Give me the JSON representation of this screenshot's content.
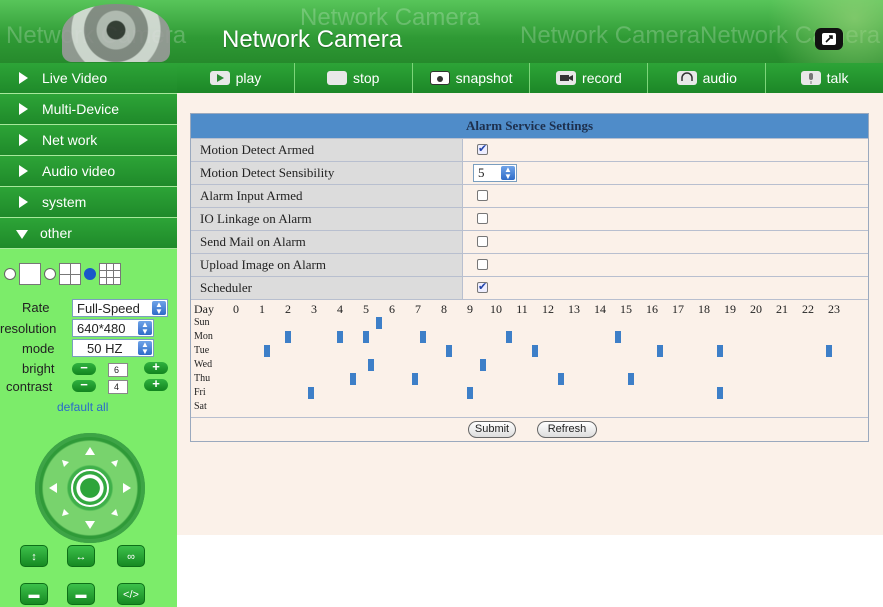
{
  "header": {
    "title": "Network Camera",
    "watermark": "Network Camera",
    "fullscreen_icon": "fullscreen-icon"
  },
  "sidebar": {
    "menu": [
      {
        "label": "Live Video",
        "expanded": false
      },
      {
        "label": "Multi-Device",
        "expanded": false
      },
      {
        "label": "Net work",
        "expanded": false
      },
      {
        "label": "Audio video",
        "expanded": false
      },
      {
        "label": "system",
        "expanded": false
      },
      {
        "label": "other",
        "expanded": true
      }
    ],
    "controls": {
      "rate_label": "Rate",
      "rate_value": "Full-Speed",
      "resolution_label": "resolution",
      "resolution_value": "640*480",
      "mode_label": "mode",
      "mode_value": "50 HZ",
      "bright_label": "bright",
      "bright_value": "6",
      "contrast_label": "contrast",
      "contrast_value": "4",
      "default_all": "default all"
    }
  },
  "toolbar": {
    "items": [
      {
        "label": "play",
        "icon": "play-icon"
      },
      {
        "label": "stop",
        "icon": "stop-icon"
      },
      {
        "label": "snapshot",
        "icon": "camera-icon"
      },
      {
        "label": "record",
        "icon": "record-icon"
      },
      {
        "label": "audio",
        "icon": "headphones-icon"
      },
      {
        "label": "talk",
        "icon": "microphone-icon"
      }
    ]
  },
  "panel": {
    "title": "Alarm Service Settings",
    "rows": [
      {
        "label": "Motion Detect Armed",
        "checked": true
      },
      {
        "label": "Motion Detect Sensibility",
        "select": "5"
      },
      {
        "label": "Alarm Input Armed",
        "checked": false
      },
      {
        "label": "IO Linkage on Alarm",
        "checked": false
      },
      {
        "label": "Send Mail on Alarm",
        "checked": false
      },
      {
        "label": "Upload Image on Alarm",
        "checked": false
      },
      {
        "label": "Scheduler",
        "checked": true
      }
    ],
    "scheduler": {
      "day_header": "Day",
      "hours": [
        "0",
        "1",
        "2",
        "3",
        "4",
        "5",
        "6",
        "7",
        "8",
        "9",
        "10",
        "11",
        "12",
        "13",
        "14",
        "15",
        "16",
        "17",
        "18",
        "19",
        "20",
        "21",
        "22",
        "23"
      ],
      "days": [
        "Sun",
        "Mon",
        "Tue",
        "Wed",
        "Thu",
        "Fri",
        "Sat"
      ],
      "marks": [
        {
          "day": 0,
          "hour": 5.5
        },
        {
          "day": 1,
          "hour": 2.0
        },
        {
          "day": 1,
          "hour": 4.0
        },
        {
          "day": 1,
          "hour": 5.0
        },
        {
          "day": 1,
          "hour": 7.2
        },
        {
          "day": 1,
          "hour": 10.5
        },
        {
          "day": 1,
          "hour": 14.7
        },
        {
          "day": 2,
          "hour": 1.2
        },
        {
          "day": 2,
          "hour": 8.2
        },
        {
          "day": 2,
          "hour": 11.5
        },
        {
          "day": 2,
          "hour": 16.3
        },
        {
          "day": 2,
          "hour": 18.6
        },
        {
          "day": 2,
          "hour": 22.8
        },
        {
          "day": 3,
          "hour": 5.2
        },
        {
          "day": 3,
          "hour": 9.5
        },
        {
          "day": 4,
          "hour": 4.5
        },
        {
          "day": 4,
          "hour": 6.9
        },
        {
          "day": 4,
          "hour": 12.5
        },
        {
          "day": 4,
          "hour": 15.2
        },
        {
          "day": 5,
          "hour": 2.9
        },
        {
          "day": 5,
          "hour": 9.0
        },
        {
          "day": 5,
          "hour": 18.6
        }
      ]
    },
    "submit_label": "Submit",
    "refresh_label": "Refresh"
  }
}
